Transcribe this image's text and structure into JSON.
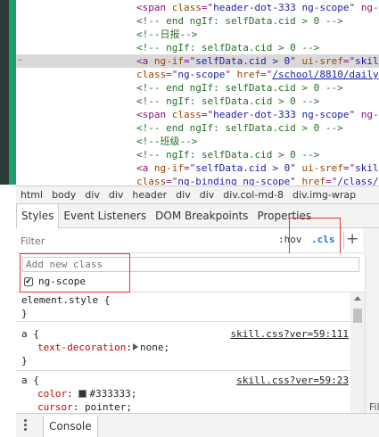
{
  "elements": {
    "lines": [
      {
        "segs": [
          {
            "c": "t-tag",
            "t": "<span "
          },
          {
            "c": "t-attr",
            "t": "class"
          },
          {
            "c": "t-tag",
            "t": "=\""
          },
          {
            "c": "t-val",
            "t": "header-dot-333 ng-scope"
          },
          {
            "c": "t-tag",
            "t": "\" ng-"
          }
        ]
      },
      {
        "segs": [
          {
            "c": "t-com",
            "t": "<!-- end ngIf: selfData.cid > 0 -->"
          }
        ]
      },
      {
        "segs": [
          {
            "c": "t-com",
            "t": "<!--日报-->"
          }
        ]
      },
      {
        "segs": [
          {
            "c": "t-com",
            "t": "<!-- ngIf: selfData.cid > 0 -->"
          }
        ]
      },
      {
        "segs": [
          {
            "c": "t-tag",
            "t": "<a "
          },
          {
            "c": "t-attr",
            "t": "ng-if"
          },
          {
            "c": "t-tag",
            "t": "=\""
          },
          {
            "c": "t-val",
            "t": "selfData.cid > 0"
          },
          {
            "c": "t-tag",
            "t": "\" "
          },
          {
            "c": "t-attr",
            "t": "ui-sref"
          },
          {
            "c": "t-tag",
            "t": "=\""
          },
          {
            "c": "t-val",
            "t": "skil"
          }
        ]
      },
      {
        "segs": [
          {
            "c": "t-attr",
            "t": "class"
          },
          {
            "c": "t-tag",
            "t": "=\""
          },
          {
            "c": "t-val",
            "t": "ng-scope"
          },
          {
            "c": "t-tag",
            "t": "\" "
          },
          {
            "c": "t-attr",
            "t": "href"
          },
          {
            "c": "t-tag",
            "t": "=\""
          },
          {
            "c": "t-link",
            "t": "/school/8810/daily"
          }
        ]
      },
      {
        "segs": [
          {
            "c": "t-com",
            "t": "<!-- end ngIf: selfData.cid > 0 -->"
          }
        ]
      },
      {
        "segs": [
          {
            "c": "t-com",
            "t": "<!-- ngIf: selfData.cid > 0 -->"
          }
        ]
      },
      {
        "segs": [
          {
            "c": "t-tag",
            "t": "<span "
          },
          {
            "c": "t-attr",
            "t": "class"
          },
          {
            "c": "t-tag",
            "t": "=\""
          },
          {
            "c": "t-val",
            "t": "header-dot-333 ng-scope"
          },
          {
            "c": "t-tag",
            "t": "\" ng-"
          }
        ]
      },
      {
        "segs": [
          {
            "c": "t-com",
            "t": "<!-- end ngIf: selfData.cid > 0 -->"
          }
        ]
      },
      {
        "segs": [
          {
            "c": "t-com",
            "t": "<!--班级-->"
          }
        ]
      },
      {
        "segs": [
          {
            "c": "t-com",
            "t": "<!-- ngIf: selfData.cid > 0 -->"
          }
        ]
      },
      {
        "segs": [
          {
            "c": "t-tag",
            "t": "<a "
          },
          {
            "c": "t-attr",
            "t": "ng-if"
          },
          {
            "c": "t-tag",
            "t": "=\""
          },
          {
            "c": "t-val",
            "t": "selfData.cid > 0"
          },
          {
            "c": "t-tag",
            "t": "\" "
          },
          {
            "c": "t-attr",
            "t": "ui-sref"
          },
          {
            "c": "t-tag",
            "t": "=\""
          },
          {
            "c": "t-val",
            "t": "skil"
          }
        ]
      },
      {
        "segs": [
          {
            "c": "t-attr",
            "t": "class"
          },
          {
            "c": "t-tag",
            "t": "=\""
          },
          {
            "c": "t-val",
            "t": "ng-binding ng-scope"
          },
          {
            "c": "t-tag",
            "t": "\" "
          },
          {
            "c": "t-attr",
            "t": "href"
          },
          {
            "c": "t-tag",
            "t": "=\""
          },
          {
            "c": "t-link",
            "t": "/class/"
          }
        ]
      }
    ],
    "selected_index": 4,
    "more_marker": "…"
  },
  "breadcrumbs": [
    "html",
    "body",
    "div",
    "div",
    "header",
    "div",
    "div",
    "div.col-md-8",
    "div.img-wrap"
  ],
  "tabs": [
    "Styles",
    "Event Listeners",
    "DOM Breakpoints",
    "Properties"
  ],
  "active_tab": "Styles",
  "filter": {
    "placeholder": "Filter",
    "hov_label": ":hov",
    "cls_label": ".cls",
    "add_label": "+"
  },
  "class_panel": {
    "placeholder": "Add new class",
    "class_name": "ng-scope",
    "checked": true
  },
  "rules": {
    "element_style": {
      "selector": "element.style {",
      "close": "}"
    },
    "rule1": {
      "selector": "a {",
      "source": "skill.css?ver=59:111",
      "prop": "text-decoration",
      "value": "none;",
      "close": "}"
    },
    "rule2": {
      "selector": "a {",
      "source": "skill.css?ver=59:23",
      "prop1": "color",
      "value1": "#333333;",
      "prop2": "cursor",
      "value2": "pointer;"
    }
  },
  "right_label": "Fil",
  "drawer": {
    "console_label": "Console"
  },
  "colors": {
    "highlight_box": "#e0343a",
    "cls_active": "#1a73e8",
    "swatch": "#333333"
  }
}
